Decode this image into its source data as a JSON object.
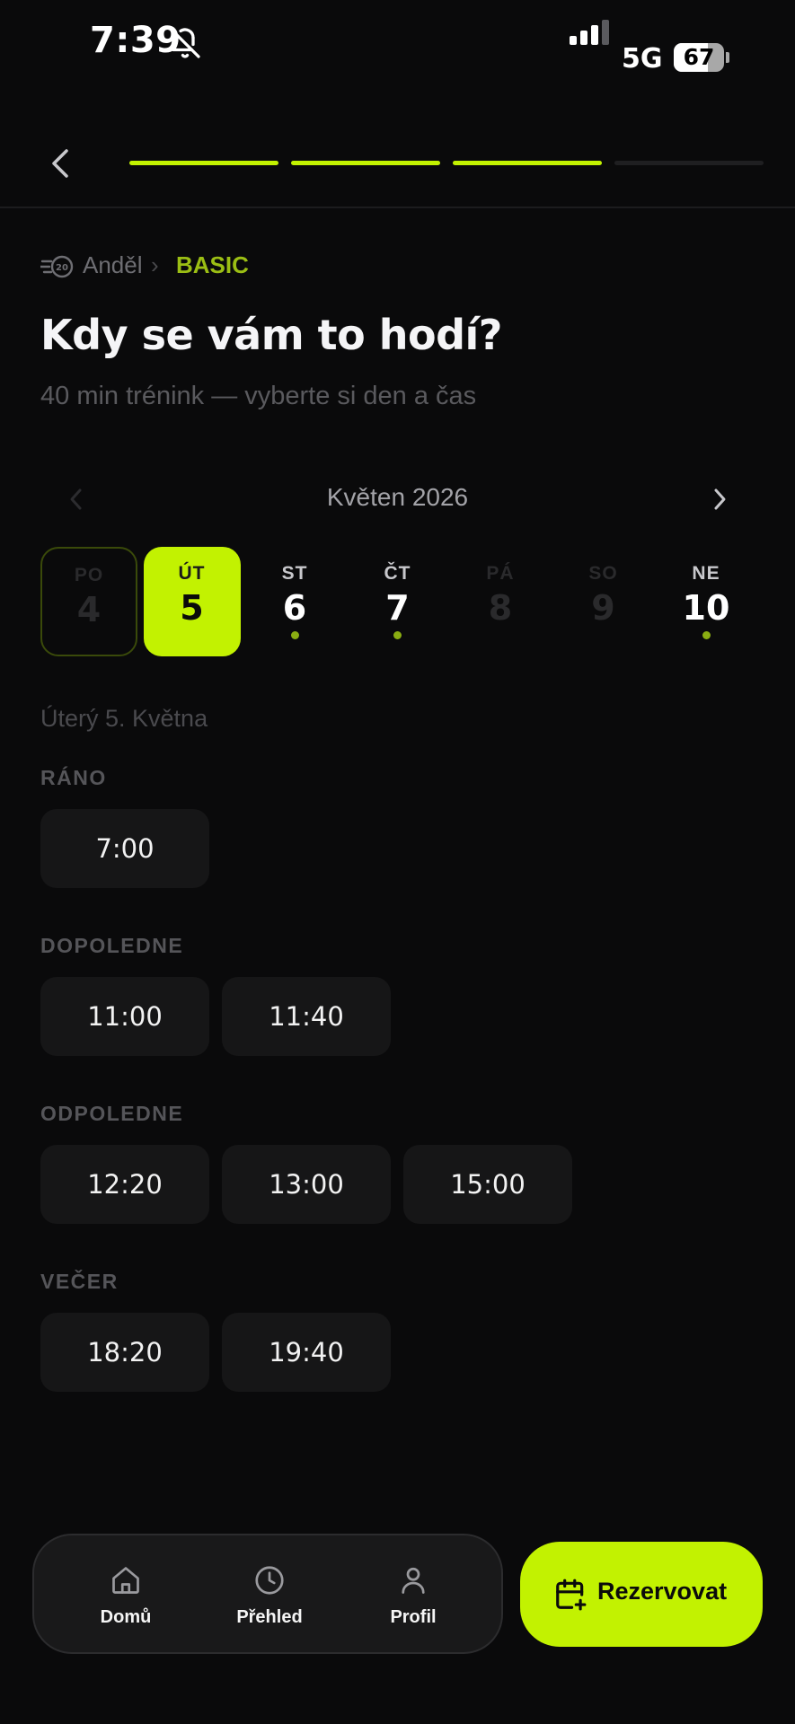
{
  "status_bar": {
    "time": "7:39",
    "network": "5G",
    "battery_percent": "67",
    "battery_level": 0.67,
    "signal_bars": 3,
    "icons": [
      "bell-off-icon",
      "signal-icon",
      "battery-icon"
    ]
  },
  "header": {
    "back_icon": "chevron-left-icon",
    "progress": {
      "total_steps": 4,
      "completed_steps": 3,
      "active_color": "#c2f201",
      "inactive_color": "#1f1f21"
    }
  },
  "breadcrumb": {
    "icon": "fast-clock-icon",
    "location": "Anděl",
    "separator": "›",
    "plan": "BASIC"
  },
  "title": "Kdy se vám to hodí?",
  "subtitle": "40 min trénink — vyberte si den a čas",
  "calendar": {
    "month_label": "Květen 2026",
    "prev_icon": "chevron-left-icon",
    "next_icon": "chevron-right-icon",
    "days": [
      {
        "dow": "PO",
        "num": "4",
        "state": "past-outline",
        "has_slots": false
      },
      {
        "dow": "ÚT",
        "num": "5",
        "state": "selected",
        "has_slots": false
      },
      {
        "dow": "ST",
        "num": "6",
        "state": "available",
        "has_slots": true
      },
      {
        "dow": "ČT",
        "num": "7",
        "state": "available",
        "has_slots": true
      },
      {
        "dow": "PÁ",
        "num": "8",
        "state": "disabled",
        "has_slots": false
      },
      {
        "dow": "SO",
        "num": "9",
        "state": "disabled",
        "has_slots": false
      },
      {
        "dow": "NE",
        "num": "10",
        "state": "available",
        "has_slots": true
      }
    ]
  },
  "selected_date_label": "Úterý 5. Května",
  "slot_groups": [
    {
      "label": "RÁNO",
      "times": [
        "7:00"
      ]
    },
    {
      "label": "DOPOLEDNE",
      "times": [
        "11:00",
        "11:40"
      ]
    },
    {
      "label": "ODPOLEDNE",
      "times": [
        "12:20",
        "13:00",
        "15:00"
      ]
    },
    {
      "label": "VEČER",
      "times": [
        "18:20",
        "19:40"
      ]
    }
  ],
  "bottom_nav": {
    "items": [
      {
        "label": "Domů",
        "icon": "home-icon"
      },
      {
        "label": "Přehled",
        "icon": "clock-icon"
      },
      {
        "label": "Profil",
        "icon": "user-icon"
      }
    ],
    "cta": {
      "label": "Rezervovat",
      "icon": "calendar-plus-icon"
    }
  },
  "colors": {
    "background": "#0a0a0b",
    "accent": "#c2f201",
    "accent_dim": "#9bbe14",
    "slot_bg": "#161617"
  }
}
